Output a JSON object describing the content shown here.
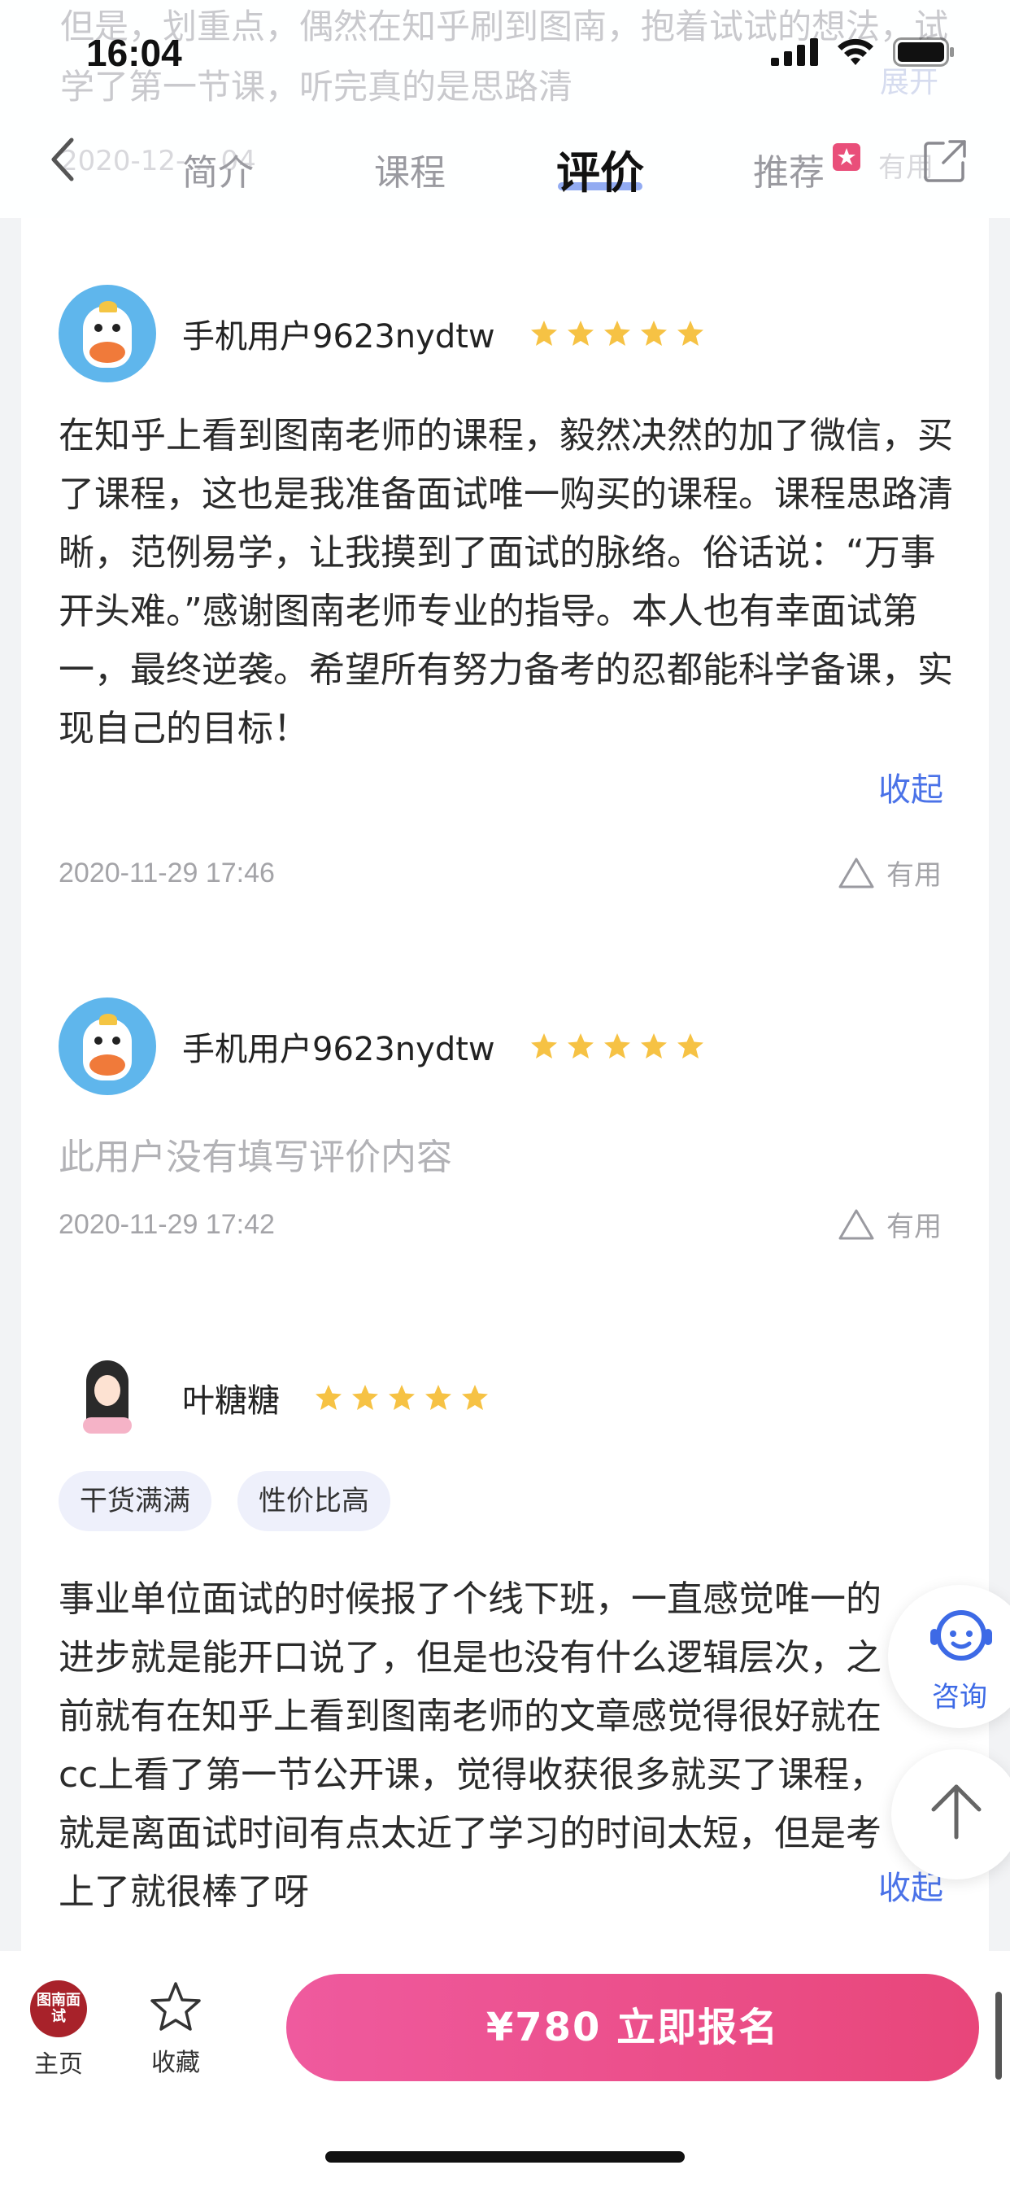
{
  "status_bar": {
    "time": "16:04"
  },
  "header": {
    "ghost_text": "但是，划重点，偶然在知乎刷到图南，抱着试试的想法，试学了第一节课，听完真的是思路清",
    "ghost_more": "展开",
    "ghost_date": "2020-12-... 04",
    "ghost_useful": "有用",
    "tabs": [
      {
        "label": "简介"
      },
      {
        "label": "课程"
      },
      {
        "label": "评价"
      },
      {
        "label": "推荐"
      }
    ],
    "active_tab": "评价"
  },
  "reviews": [
    {
      "username": "手机用户9623nydtw",
      "rating": 5,
      "text": "在知乎上看到图南老师的课程，毅然决然的加了微信，买了课程，这也是我准备面试唯一购买的课程。课程思路清晰，范例易学，让我摸到了面试的脉络。俗话说：“万事开头难。”感谢图南老师专业的指导。本人也有幸面试第一，最终逆袭。希望所有努力备考的忍都能科学备课，实现自己的目标！",
      "collapse_label": "收起",
      "date": "2020-11-29 17:46",
      "useful_label": "有用"
    },
    {
      "username": "手机用户9623nydtw",
      "rating": 5,
      "empty_text": "此用户没有填写评价内容",
      "date": "2020-11-29 17:42",
      "useful_label": "有用"
    },
    {
      "username": "叶糖糖",
      "rating": 5,
      "tags": [
        "干货满满",
        "性价比高"
      ],
      "text": "事业单位面试的时候报了个线下班，一直感觉唯一的进步就是能开口说了，但是也没有什么逻辑层次，之前就有在知乎上看到图南老师的文章感觉得很好就在cc上看了第一节公开课，觉得收获很多就买了课程，就是离面试时间有点太近了学习的时间太短，但是考上了就很棒了呀",
      "collapse_label": "收起"
    }
  ],
  "floating": {
    "consult_label": "咨询"
  },
  "bottom_bar": {
    "logo_text": "图南面试",
    "home_label": "主页",
    "favorite_label": "收藏",
    "enroll_label": "¥780  立即报名"
  },
  "colors": {
    "accent": "#4a72e8",
    "star": "#f6c244",
    "enroll": "#e94f86"
  }
}
